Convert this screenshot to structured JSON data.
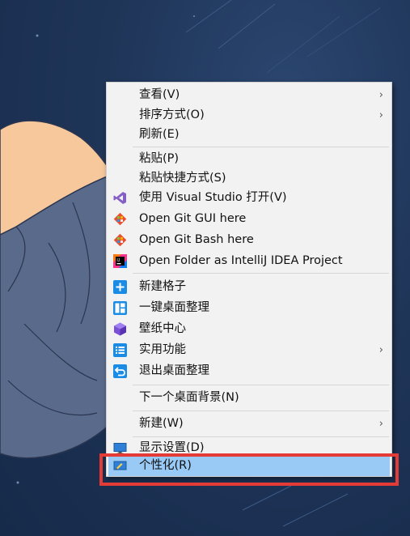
{
  "menu": {
    "items": [
      {
        "label": "查看(V)",
        "icon": "",
        "submenu": true
      },
      {
        "label": "排序方式(O)",
        "icon": "",
        "submenu": true
      },
      {
        "label": "刷新(E)",
        "icon": "",
        "submenu": false
      },
      {
        "label": "粘贴(P)",
        "icon": "",
        "submenu": false
      },
      {
        "label": "粘贴快捷方式(S)",
        "icon": "",
        "submenu": false
      },
      {
        "label": "使用 Visual Studio 打开(V)",
        "icon": "visual-studio-icon",
        "submenu": false
      },
      {
        "label": "Open Git GUI here",
        "icon": "git-gui-icon",
        "submenu": false
      },
      {
        "label": "Open Git Bash here",
        "icon": "git-bash-icon",
        "submenu": false
      },
      {
        "label": "Open Folder as IntelliJ IDEA Project",
        "icon": "intellij-idea-icon",
        "submenu": false
      },
      {
        "label": "新建格子",
        "icon": "plus-tile-icon",
        "submenu": false
      },
      {
        "label": "一键桌面整理",
        "icon": "layout-tile-icon",
        "submenu": false
      },
      {
        "label": "壁纸中心",
        "icon": "cube-icon",
        "submenu": false
      },
      {
        "label": "实用功能",
        "icon": "list-tile-icon",
        "submenu": true
      },
      {
        "label": "退出桌面整理",
        "icon": "exit-tile-icon",
        "submenu": false
      },
      {
        "label": "下一个桌面背景(N)",
        "icon": "",
        "submenu": false
      },
      {
        "label": "新建(W)",
        "icon": "",
        "submenu": true
      },
      {
        "label": "显示设置(D)",
        "icon": "display-icon",
        "submenu": false
      },
      {
        "label": "个性化(R)",
        "icon": "personalize-icon",
        "submenu": false,
        "highlighted": true
      }
    ],
    "arrow_glyph": "›"
  },
  "colors": {
    "highlight": "#99c9f5",
    "annotation_border": "#e53b36",
    "menu_bg": "#f2f2f2",
    "accent_blue": "#1a8ce6"
  }
}
